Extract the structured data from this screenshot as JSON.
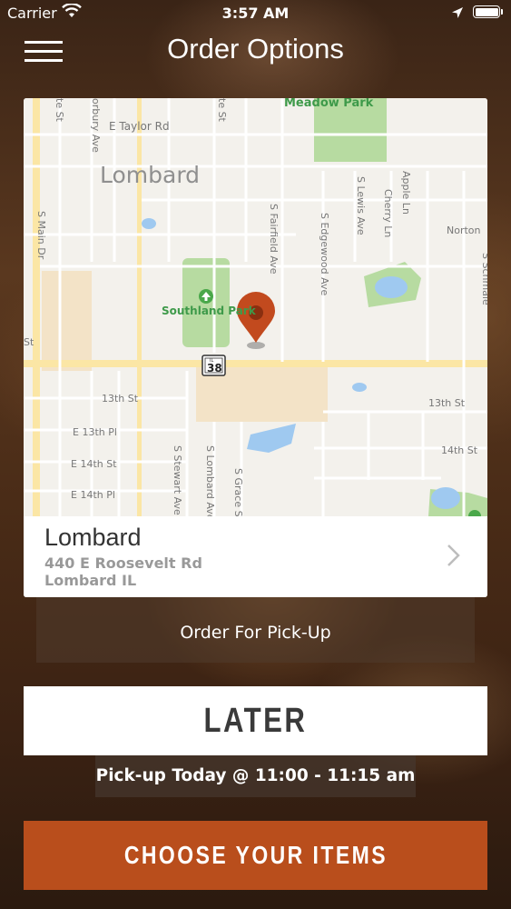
{
  "status_bar": {
    "carrier": "Carrier",
    "time": "3:57 AM"
  },
  "nav": {
    "title": "Order Options"
  },
  "map": {
    "labels": {
      "meadow_park": "Meadow Park",
      "e_taylor_rd": "E Taylor Rd",
      "lombard": "Lombard",
      "s_main_dr": "S Main Dr",
      "s_fairfield_ave": "S Fairfield Ave",
      "s_edgewood_ave": "S Edgewood Ave",
      "s_lewis_ave": "S Lewis Ave",
      "cherry_ln": "Cherry Ln",
      "apple_ln": "Apple Ln",
      "norton": "Norton",
      "southland_park": "Southland Park",
      "st": "St",
      "route_il": "IL",
      "route_38": "38",
      "13th_st_left": "13th St",
      "e_13th_pl": "E 13th Pl",
      "e_14th_st": "E 14th St",
      "e_14th_pl": "E 14th Pl",
      "s_stewart_ave": "S Stewart Ave",
      "s_lombard_ave": "S Lombard Ave",
      "s_grace_st": "S Grace St",
      "13th_st_right": "13th St",
      "14th_st": "14th St",
      "te_st": "te St",
      "orbury_ave": "orbury Ave",
      "te_st_2": "te St",
      "schmale": "S Schmale"
    }
  },
  "location": {
    "name": "Lombard",
    "address_line1": "440 E Roosevelt Rd",
    "address_line2": "Lombard IL"
  },
  "order_type": "Order For Pick-Up",
  "later_label": "LATER",
  "pickup_time": "Pick-up Today @ 11:00 - 11:15 am",
  "cta_label": "CHOOSE YOUR ITEMS",
  "colors": {
    "accent": "#b94e1c",
    "pin": "#c24a1e",
    "park": "#b7dba1",
    "water": "#9fc9f0"
  }
}
